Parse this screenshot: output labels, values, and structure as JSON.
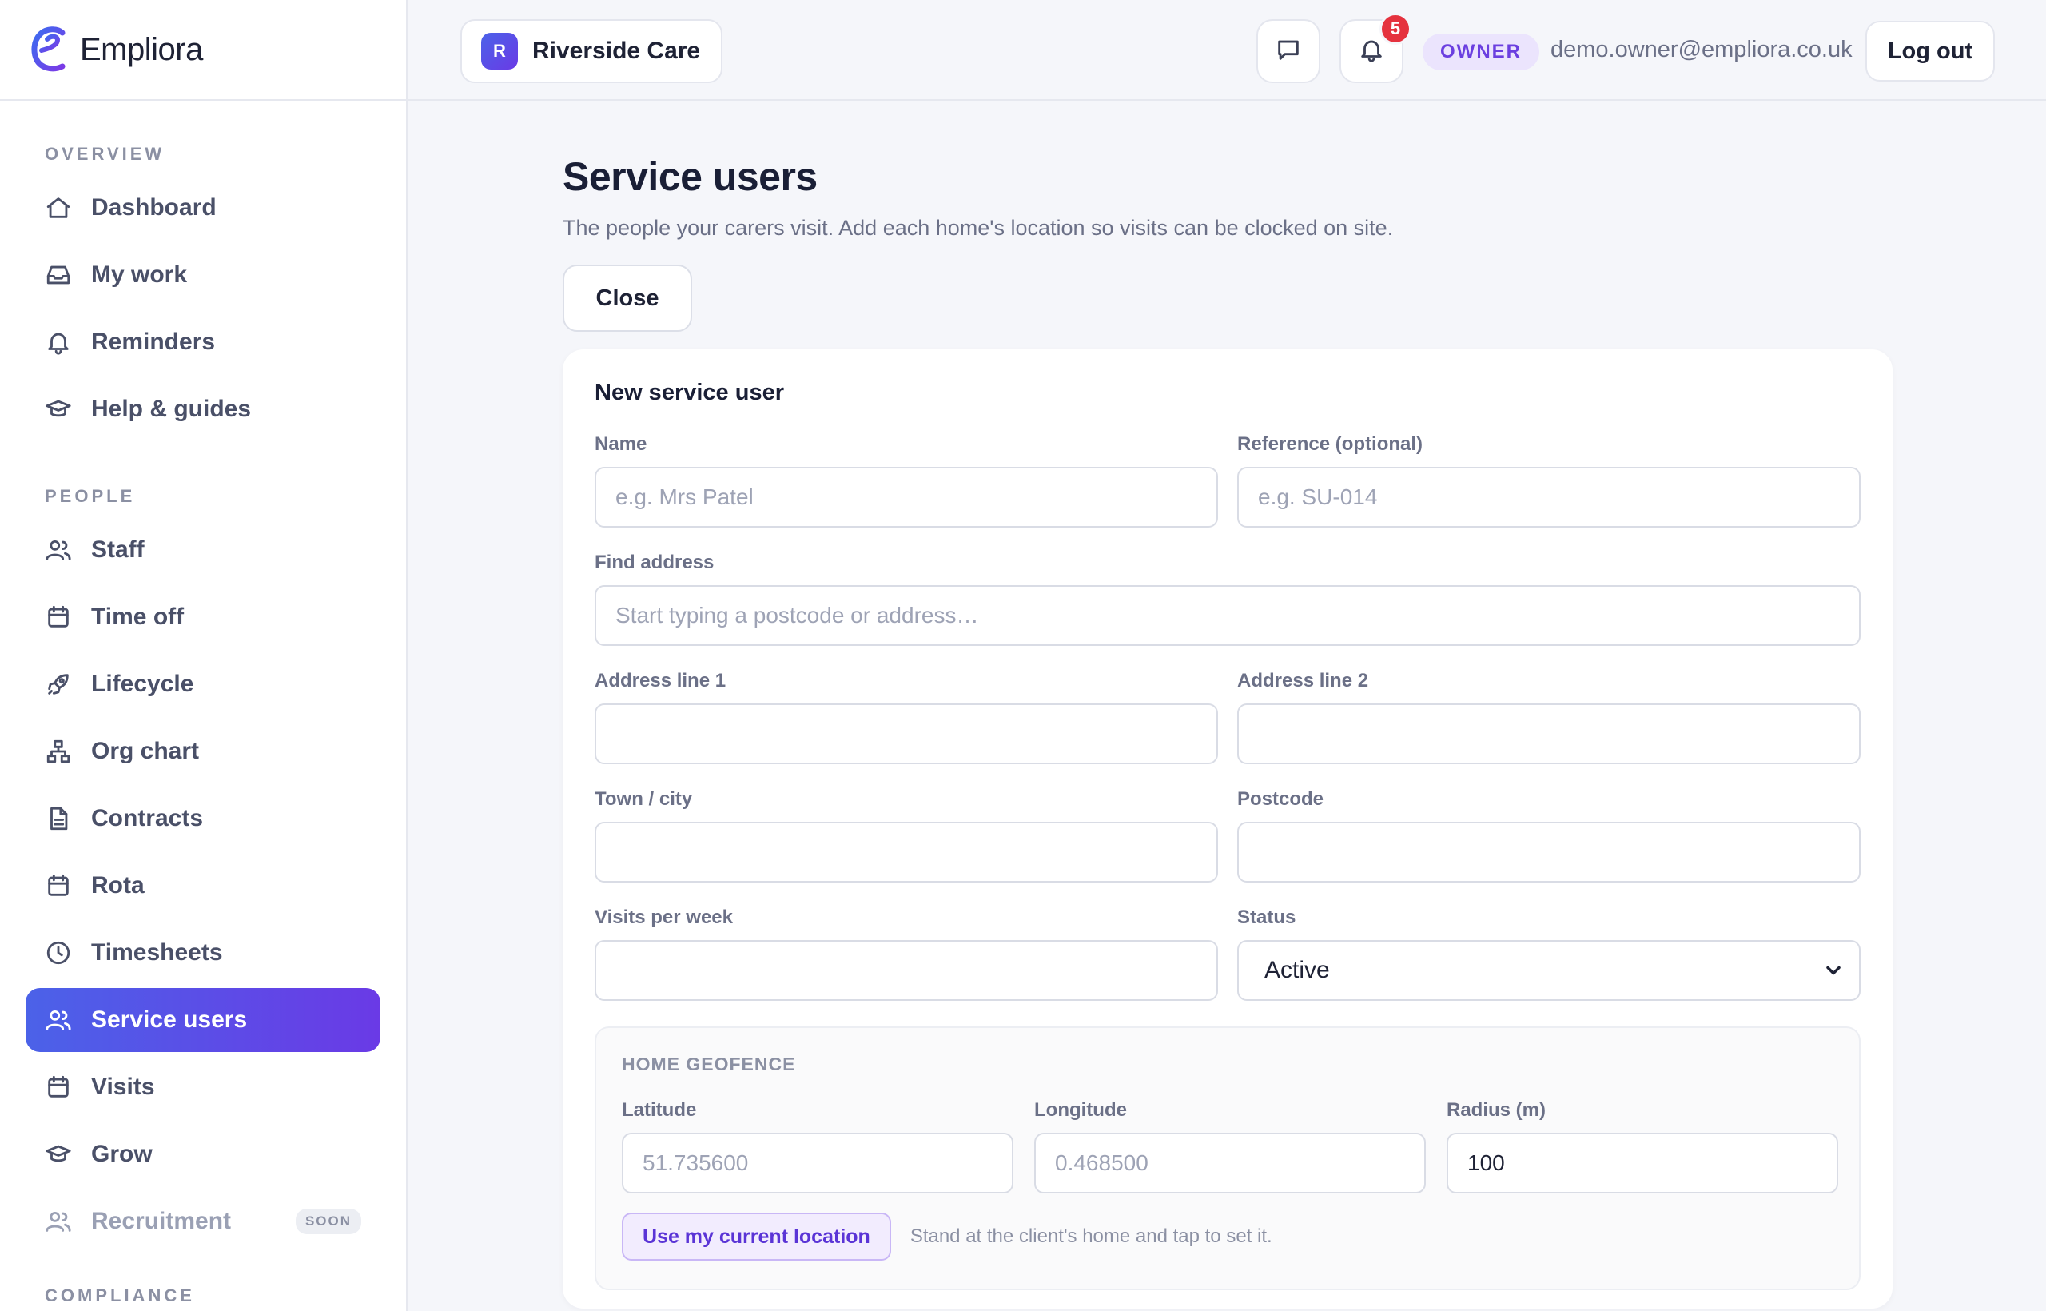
{
  "brand": {
    "name": "Empliora"
  },
  "sidebar": {
    "sections": [
      {
        "title": "OVERVIEW",
        "items": [
          {
            "label": "Dashboard",
            "icon": "home-icon"
          },
          {
            "label": "My work",
            "icon": "inbox-icon"
          },
          {
            "label": "Reminders",
            "icon": "bell-icon"
          },
          {
            "label": "Help & guides",
            "icon": "graduation-cap-icon"
          }
        ]
      },
      {
        "title": "PEOPLE",
        "items": [
          {
            "label": "Staff",
            "icon": "users-icon"
          },
          {
            "label": "Time off",
            "icon": "calendar-icon"
          },
          {
            "label": "Lifecycle",
            "icon": "rocket-icon"
          },
          {
            "label": "Org chart",
            "icon": "org-chart-icon"
          },
          {
            "label": "Contracts",
            "icon": "document-icon"
          },
          {
            "label": "Rota",
            "icon": "calendar-icon"
          },
          {
            "label": "Timesheets",
            "icon": "clock-icon"
          },
          {
            "label": "Service users",
            "icon": "users-icon",
            "active": true
          },
          {
            "label": "Visits",
            "icon": "calendar-icon"
          },
          {
            "label": "Grow",
            "icon": "graduation-cap-icon"
          },
          {
            "label": "Recruitment",
            "icon": "users-icon",
            "badge": "SOON"
          }
        ]
      },
      {
        "title": "COMPLIANCE",
        "items": []
      }
    ]
  },
  "topbar": {
    "org_initial": "R",
    "org_name": "Riverside Care",
    "notification_count": "5",
    "role": "OWNER",
    "email": "demo.owner@empliora.co.uk",
    "logout_label": "Log out"
  },
  "page": {
    "title": "Service users",
    "subtitle": "The people your carers visit. Add each home's location so visits can be clocked on site.",
    "close_label": "Close"
  },
  "form": {
    "title": "New service user",
    "name": {
      "label": "Name",
      "placeholder": "e.g. Mrs Patel",
      "value": ""
    },
    "reference": {
      "label": "Reference (optional)",
      "placeholder": "e.g. SU-014",
      "value": ""
    },
    "find_address": {
      "label": "Find address",
      "placeholder": "Start typing a postcode or address…"
    },
    "address1": {
      "label": "Address line 1",
      "value": ""
    },
    "address2": {
      "label": "Address line 2",
      "value": ""
    },
    "town": {
      "label": "Town / city",
      "value": ""
    },
    "postcode": {
      "label": "Postcode",
      "value": ""
    },
    "visits_per_week": {
      "label": "Visits per week",
      "value": ""
    },
    "status": {
      "label": "Status",
      "value": "Active"
    },
    "geofence": {
      "title": "HOME GEOFENCE",
      "latitude": {
        "label": "Latitude",
        "placeholder": "51.735600"
      },
      "longitude": {
        "label": "Longitude",
        "placeholder": "0.468500"
      },
      "radius": {
        "label": "Radius (m)",
        "value": "100"
      },
      "use_location_label": "Use my current location",
      "hint": "Stand at the client's home and tap to set it."
    }
  },
  "colors": {
    "accent_start": "#4b62e8",
    "accent_end": "#6a3ae6",
    "badge": "#e5323e"
  }
}
